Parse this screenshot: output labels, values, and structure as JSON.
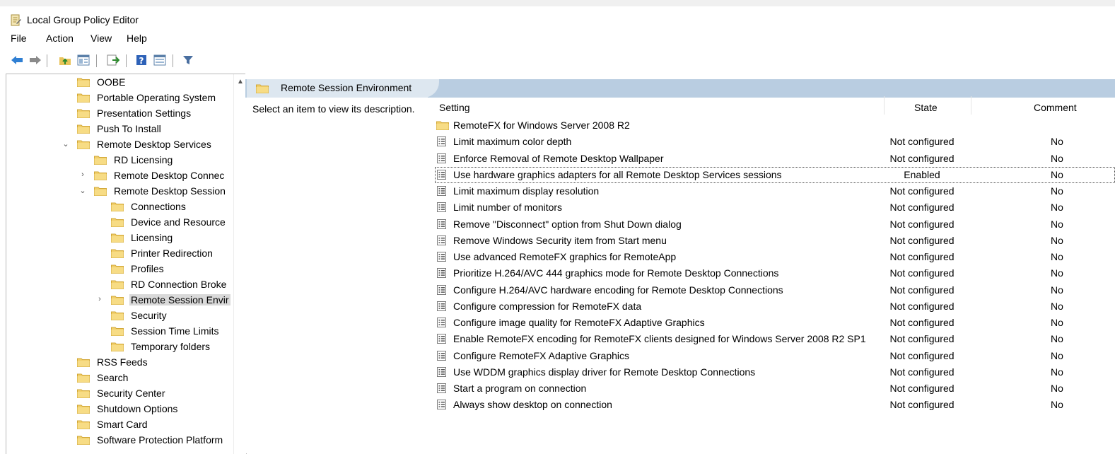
{
  "window": {
    "title": "Local Group Policy Editor"
  },
  "menu": [
    "File",
    "Action",
    "View",
    "Help"
  ],
  "toolbar": {
    "buttons": [
      "back-arrow-icon",
      "forward-arrow-icon",
      "up-folder-icon",
      "show-hide-tree-icon",
      "export-list-icon",
      "help-icon",
      "properties-view-icon",
      "filter-icon"
    ]
  },
  "tree": {
    "items": [
      {
        "label": "OOBE",
        "level": 0,
        "expander": ""
      },
      {
        "label": "Portable Operating System",
        "level": 0,
        "expander": ""
      },
      {
        "label": "Presentation Settings",
        "level": 0,
        "expander": ""
      },
      {
        "label": "Push To Install",
        "level": 0,
        "expander": ""
      },
      {
        "label": "Remote Desktop Services",
        "level": 0,
        "expander": "expanded"
      },
      {
        "label": "RD Licensing",
        "level": 1,
        "expander": ""
      },
      {
        "label": "Remote Desktop Connec",
        "level": 1,
        "expander": "collapsed"
      },
      {
        "label": "Remote Desktop Session",
        "level": 1,
        "expander": "expanded"
      },
      {
        "label": "Connections",
        "level": 2,
        "expander": ""
      },
      {
        "label": "Device and Resource",
        "level": 2,
        "expander": ""
      },
      {
        "label": "Licensing",
        "level": 2,
        "expander": ""
      },
      {
        "label": "Printer Redirection",
        "level": 2,
        "expander": ""
      },
      {
        "label": "Profiles",
        "level": 2,
        "expander": ""
      },
      {
        "label": "RD Connection Broke",
        "level": 2,
        "expander": ""
      },
      {
        "label": "Remote Session Envir",
        "level": 2,
        "expander": "collapsed",
        "selected": true
      },
      {
        "label": "Security",
        "level": 2,
        "expander": ""
      },
      {
        "label": "Session Time Limits",
        "level": 2,
        "expander": ""
      },
      {
        "label": "Temporary folders",
        "level": 2,
        "expander": ""
      },
      {
        "label": "RSS Feeds",
        "level": 0,
        "expander": ""
      },
      {
        "label": "Search",
        "level": 0,
        "expander": ""
      },
      {
        "label": "Security Center",
        "level": 0,
        "expander": ""
      },
      {
        "label": "Shutdown Options",
        "level": 0,
        "expander": ""
      },
      {
        "label": "Smart Card",
        "level": 0,
        "expander": ""
      },
      {
        "label": "Software Protection Platform",
        "level": 0,
        "expander": ""
      }
    ]
  },
  "details": {
    "header": "Remote Session Environment",
    "description": "Select an item to view its description.",
    "columns": {
      "setting": "Setting",
      "state": "State",
      "comment": "Comment"
    },
    "rows": [
      {
        "type": "folder",
        "name": "RemoteFX for Windows Server 2008 R2",
        "state": "",
        "comment": ""
      },
      {
        "type": "policy",
        "name": "Limit maximum color depth",
        "state": "Not configured",
        "comment": "No"
      },
      {
        "type": "policy",
        "name": "Enforce Removal of Remote Desktop Wallpaper",
        "state": "Not configured",
        "comment": "No"
      },
      {
        "type": "policy",
        "name": "Use hardware graphics adapters for all Remote Desktop Services sessions",
        "state": "Enabled",
        "comment": "No",
        "focused": true
      },
      {
        "type": "policy",
        "name": "Limit maximum display resolution",
        "state": "Not configured",
        "comment": "No"
      },
      {
        "type": "policy",
        "name": "Limit number of monitors",
        "state": "Not configured",
        "comment": "No"
      },
      {
        "type": "policy",
        "name": "Remove \"Disconnect\" option from Shut Down dialog",
        "state": "Not configured",
        "comment": "No"
      },
      {
        "type": "policy",
        "name": "Remove Windows Security item from Start menu",
        "state": "Not configured",
        "comment": "No"
      },
      {
        "type": "policy",
        "name": "Use advanced RemoteFX graphics for RemoteApp",
        "state": "Not configured",
        "comment": "No"
      },
      {
        "type": "policy",
        "name": "Prioritize H.264/AVC 444 graphics mode for Remote Desktop Connections",
        "state": "Not configured",
        "comment": "No"
      },
      {
        "type": "policy",
        "name": "Configure H.264/AVC hardware encoding for Remote Desktop Connections",
        "state": "Not configured",
        "comment": "No"
      },
      {
        "type": "policy",
        "name": "Configure compression for RemoteFX data",
        "state": "Not configured",
        "comment": "No"
      },
      {
        "type": "policy",
        "name": "Configure image quality for RemoteFX Adaptive Graphics",
        "state": "Not configured",
        "comment": "No"
      },
      {
        "type": "policy",
        "name": "Enable RemoteFX encoding for RemoteFX clients designed for Windows Server 2008 R2 SP1",
        "state": "Not configured",
        "comment": "No"
      },
      {
        "type": "policy",
        "name": "Configure RemoteFX Adaptive Graphics",
        "state": "Not configured",
        "comment": "No"
      },
      {
        "type": "policy",
        "name": "Use WDDM graphics display driver for Remote Desktop Connections",
        "state": "Not configured",
        "comment": "No"
      },
      {
        "type": "policy",
        "name": "Start a program on connection",
        "state": "Not configured",
        "comment": "No"
      },
      {
        "type": "policy",
        "name": "Always show desktop on connection",
        "state": "Not configured",
        "comment": "No"
      }
    ]
  }
}
